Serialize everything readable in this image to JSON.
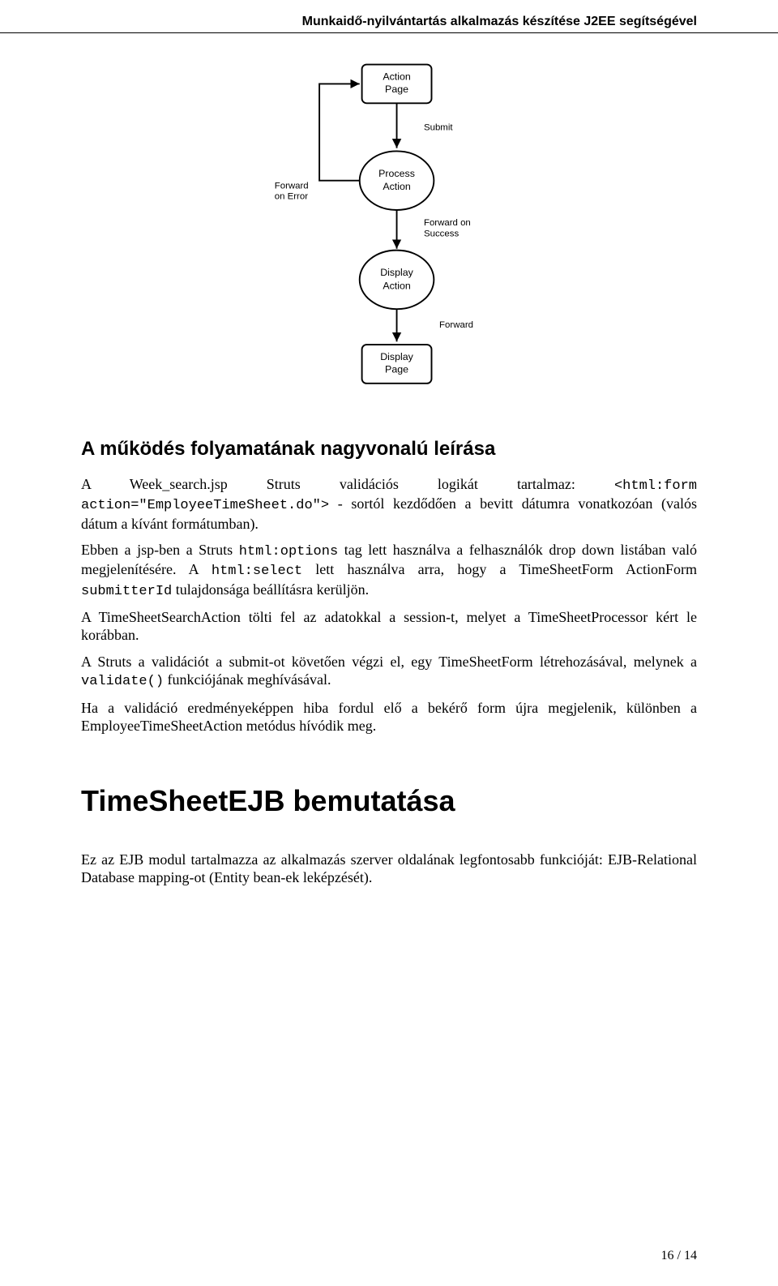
{
  "header": {
    "running_title": "Munkaidő-nyilvántartás alkalmazás készítése J2EE segítségével"
  },
  "figure": {
    "nodes": {
      "action_page_l1": "Action",
      "action_page_l2": "Page",
      "process_action_l1": "Process",
      "process_action_l2": "Action",
      "display_action_l1": "Display",
      "display_action_l2": "Action",
      "display_page_l1": "Display",
      "display_page_l2": "Page"
    },
    "edges": {
      "submit": "Submit",
      "forward_on_error_l1": "Forward",
      "forward_on_error_l2": "on Error",
      "forward_on_success_l1": "Forward on",
      "forward_on_success_l2": "Success",
      "forward": "Forward"
    }
  },
  "section1": {
    "heading": "A működés folyamatának nagyvonalú leírása",
    "p1a": "A Week_search.jsp Struts validációs logikát tartalmaz: ",
    "p1code1": "<html:form action=\"EmployeeTimeSheet.do\">",
    "p1b": " - sortól kezdődően a bevitt dátumra vonatkozóan (valós dátum a kívánt formátumban).",
    "p2a": "Ebben a jsp-ben a Struts ",
    "p2code1": "html:options",
    "p2b": " tag lett használva a felhasználók drop down listában való megjelenítésére. A ",
    "p2code2": "html:select",
    "p2c": " lett használva arra, hogy a TimeSheetForm ActionForm ",
    "p2code3": "submitterId",
    "p2d": " tulajdonsága beállításra kerüljön.",
    "p3": "A TimeSheetSearchAction tölti fel az adatokkal a session-t, melyet a TimeSheetProcessor kért le korábban.",
    "p4a": "A Struts a validációt a submit-ot követően végzi el, egy TimeSheetForm létrehozásával, melynek a ",
    "p4code1": "validate()",
    "p4b": " funkciójának meghívásával.",
    "p5": "Ha a validáció eredményeképpen hiba fordul elő a bekérő form újra megjelenik, különben a EmployeeTimeSheetAction metódus hívódik meg."
  },
  "section2": {
    "heading": "TimeSheetEJB bemutatása",
    "p1": "Ez az EJB modul tartalmazza az alkalmazás szerver oldalának legfontosabb funkcióját: EJB-Relational Database mapping-ot (Entity bean-ek leképzését)."
  },
  "footer": {
    "page": "16 / 14"
  }
}
